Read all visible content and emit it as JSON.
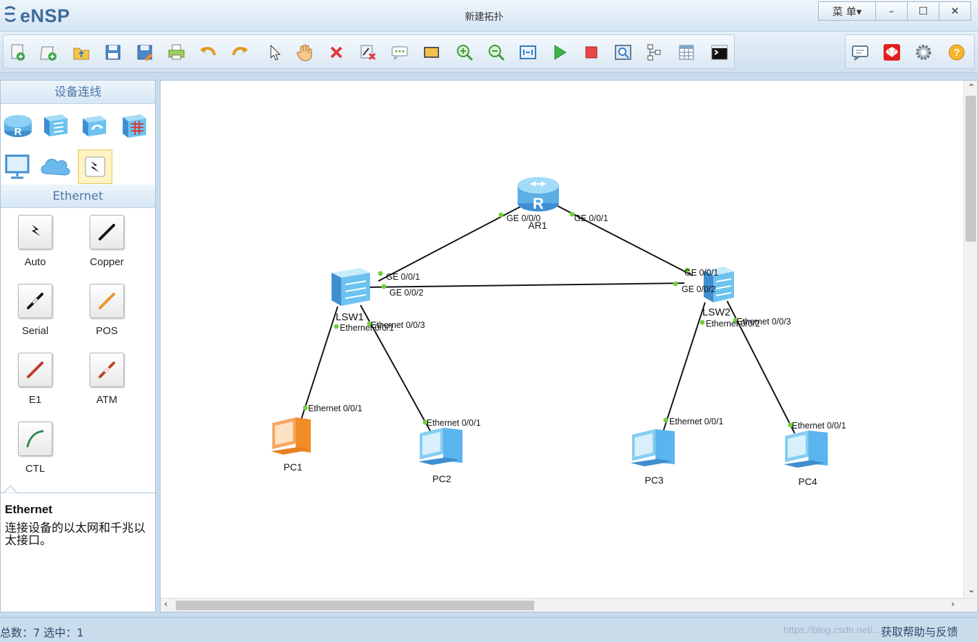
{
  "app": {
    "name": "eNSP",
    "window_title": "新建拓扑"
  },
  "window_controls": {
    "menu_label": "菜 单▾",
    "minimize": "–",
    "maximize": "☐",
    "close": "✕"
  },
  "toolbar": {
    "icons": [
      "new-topology-icon",
      "new-example-icon",
      "open-icon",
      "save-icon",
      "save-as-icon",
      "print-icon",
      "undo-icon",
      "redo-icon",
      "select-icon",
      "pan-icon",
      "delete-icon",
      "delete-link-icon",
      "text-icon",
      "rectangle-icon",
      "zoom-in-icon",
      "zoom-out-icon",
      "fit-view-icon",
      "start-device-icon",
      "stop-device-icon",
      "capture-icon",
      "topology-icon",
      "grid-icon",
      "command-line-icon"
    ],
    "right_icons": [
      "message-icon",
      "huawei-icon",
      "settings-icon",
      "help-icon"
    ]
  },
  "left_panel": {
    "section_title": "设备连线",
    "devices": [
      "router-icon",
      "switch-icon",
      "wireless-icon",
      "firewall-icon",
      "terminal-icon",
      "cloud-icon",
      "connection-icon"
    ],
    "selected_category": "Ethernet",
    "cables": [
      {
        "label": "Auto",
        "icon": "auto-cable-icon",
        "color": "#111111"
      },
      {
        "label": "Copper",
        "icon": "copper-cable-icon",
        "color": "#111111"
      },
      {
        "label": "Serial",
        "icon": "serial-cable-icon",
        "color": "#111111"
      },
      {
        "label": "POS",
        "icon": "pos-cable-icon",
        "color": "#f0922a"
      },
      {
        "label": "E1",
        "icon": "e1-cable-icon",
        "color": "#c0392b"
      },
      {
        "label": "ATM",
        "icon": "atm-cable-icon",
        "color": "#b8421a"
      },
      {
        "label": "CTL",
        "icon": "ctl-cable-icon",
        "color": "#2e8b57"
      }
    ],
    "description": {
      "title": "Ethernet",
      "text": "连接设备的以太网和千兆以太接口。"
    }
  },
  "topology": {
    "nodes": {
      "AR1": "AR1",
      "LSW1": "LSW1",
      "LSW2": "LSW2",
      "PC1": "PC1",
      "PC2": "PC2",
      "PC3": "PC3",
      "PC4": "PC4"
    },
    "ports": {
      "ar1_ge000": "GE 0/0/0",
      "ar1_ge001": "GE 0/0/1",
      "lsw1_ge001": "GE 0/0/1",
      "lsw1_ge002": "GE 0/0/2",
      "lsw2_ge001": "GE 0/0/1",
      "lsw2_ge002": "GE 0/0/2",
      "lsw1_eth001": "Ethernet 0/0/1",
      "lsw1_eth003": "Ethernet 0/0/3",
      "lsw2_eth002": "Ethernet 0/0/2",
      "lsw2_eth003": "Ethernet 0/0/3",
      "pc1_eth": "Ethernet 0/0/1",
      "pc2_eth": "Ethernet 0/0/1",
      "pc3_eth": "Ethernet 0/0/1",
      "pc4_eth": "Ethernet 0/0/1"
    },
    "colors": {
      "link": "#111111",
      "port_dot": "#6ed23a",
      "pc_active": "#f28c28",
      "pc_default": "#5ab4ee",
      "device_blue": "#6cc3f0"
    }
  },
  "status": {
    "text": "总数：7 选中：1",
    "watermark": "https://blog.csdn.net/...",
    "feedback": "获取帮助与反馈"
  }
}
